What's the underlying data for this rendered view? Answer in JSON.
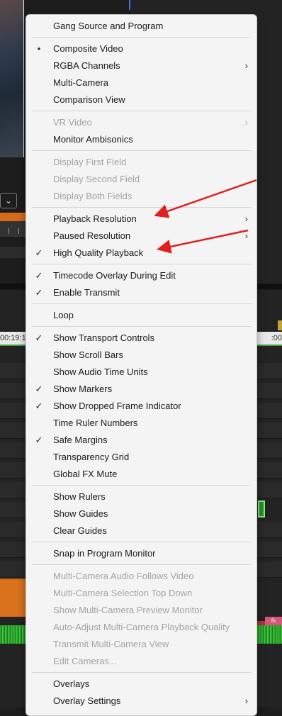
{
  "background": {
    "timecode_left": "00:19:1",
    "timecode_right": ":00",
    "dropdown_glyph": "⌄",
    "fx_badge": "fx"
  },
  "menu": {
    "check_glyph": "✓",
    "bullet_glyph": "•",
    "submenu_glyph": "›",
    "items": [
      {
        "label": "Gang Source and Program"
      },
      {
        "label": "Composite Video"
      },
      {
        "label": "RGBA Channels"
      },
      {
        "label": "Multi-Camera"
      },
      {
        "label": "Comparison View"
      },
      {
        "label": "VR Video"
      },
      {
        "label": "Monitor Ambisonics"
      },
      {
        "label": "Display First Field"
      },
      {
        "label": "Display Second Field"
      },
      {
        "label": "Display Both Fields"
      },
      {
        "label": "Playback Resolution"
      },
      {
        "label": "Paused Resolution"
      },
      {
        "label": "High Quality Playback"
      },
      {
        "label": "Timecode Overlay During Edit"
      },
      {
        "label": "Enable Transmit"
      },
      {
        "label": "Loop"
      },
      {
        "label": "Show Transport Controls"
      },
      {
        "label": "Show Scroll Bars"
      },
      {
        "label": "Show Audio Time Units"
      },
      {
        "label": "Show Markers"
      },
      {
        "label": "Show Dropped Frame Indicator"
      },
      {
        "label": "Time Ruler Numbers"
      },
      {
        "label": "Safe Margins"
      },
      {
        "label": "Transparency Grid"
      },
      {
        "label": "Global FX Mute"
      },
      {
        "label": "Show Rulers"
      },
      {
        "label": "Show Guides"
      },
      {
        "label": "Clear Guides"
      },
      {
        "label": "Snap in Program Monitor"
      },
      {
        "label": "Multi-Camera Audio Follows Video"
      },
      {
        "label": "Multi-Camera Selection Top Down"
      },
      {
        "label": "Show Multi-Camera Preview Monitor"
      },
      {
        "label": "Auto-Adjust Multi-Camera Playback Quality"
      },
      {
        "label": "Transmit Multi-Camera View"
      },
      {
        "label": "Edit Cameras..."
      },
      {
        "label": "Overlays"
      },
      {
        "label": "Overlay Settings"
      }
    ]
  },
  "annotation_color": "#e02020"
}
